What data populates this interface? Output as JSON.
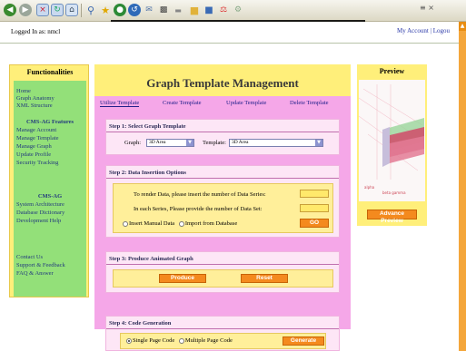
{
  "browser": {
    "right_text": "≡ ×"
  },
  "page": {
    "logged_in": "Logged In as: nmcl",
    "account_links": "My Account | Logou"
  },
  "sidebar": {
    "title": "Functionalities",
    "items_top": [
      "Home",
      "Graph Anatomy",
      "XML Structure"
    ],
    "section_cms": "CMS-AG Features",
    "items_cms": [
      "Manage Account",
      "Manage Template",
      "Manage Graph",
      "Update Profile",
      "Security Tracking"
    ],
    "section_cmsag": "CMS-AG",
    "items_cmsag": [
      "System Architecture",
      "Database Dictionary",
      "Development Help"
    ],
    "items_bottom": [
      "Contact Us",
      "Support & Feedback",
      "FAQ & Answer"
    ]
  },
  "main": {
    "title": "Graph Template Management",
    "tabs": [
      "Utilize Template",
      "Create Template",
      "Update Template",
      "Delete Template"
    ],
    "step1": {
      "title": "Step 1: Select Graph Template",
      "graph_label": "Graph:",
      "graph_value": "3D Area",
      "template_label": "Template:",
      "template_value": "3D Area"
    },
    "step2": {
      "title": "Step 2: Data Insertion Options",
      "series_text": "To render Data, please insert the number of Data Series:",
      "sets_text": "In each Series, Please provide the number of Data Set:",
      "manual_label": "Insert Manual Data",
      "import_label": "Import from Database",
      "go_label": "GO"
    },
    "step3": {
      "title": "Step 3: Produce Animated Graph",
      "produce_label": "Produce",
      "reset_label": "Reset"
    },
    "step4": {
      "title": "Step 4: Code Generation",
      "single_label": "Single Page Code",
      "multiple_label": "Multiple Page Code",
      "generate_label": "Generate"
    }
  },
  "preview": {
    "title": "Preview",
    "button_label": "Advance Preview"
  },
  "colors": {
    "yellow_panel": "#ffef7a",
    "green_sidebar": "#93e079",
    "pink_body": "#f5a7e8",
    "orange_button": "#f48a1e",
    "link_blue": "#233a7e"
  }
}
